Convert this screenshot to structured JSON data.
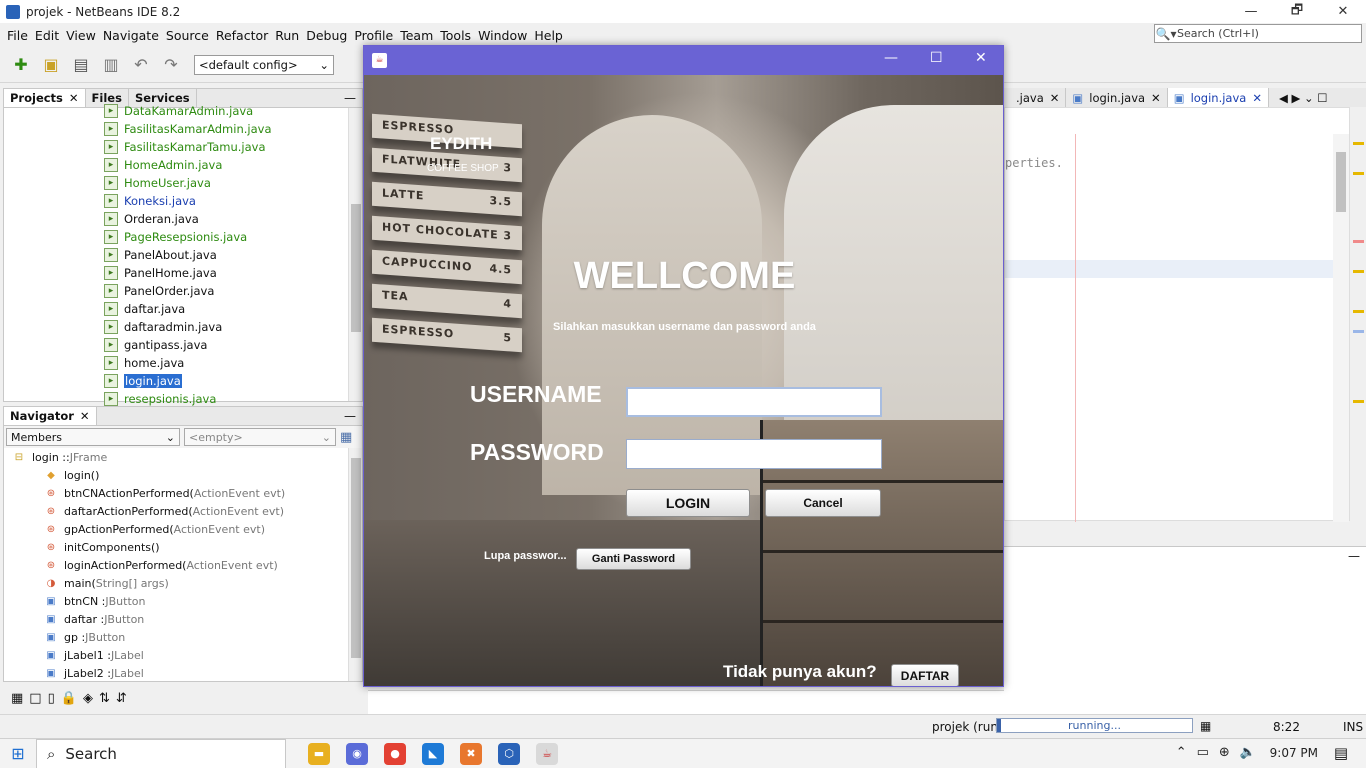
{
  "window": {
    "title": "projek - NetBeans IDE 8.2",
    "restore": "🗗",
    "close": "✕"
  },
  "menu": [
    "File",
    "Edit",
    "View",
    "Navigate",
    "Source",
    "Refactor",
    "Run",
    "Debug",
    "Profile",
    "Team",
    "Tools",
    "Window",
    "Help"
  ],
  "search": {
    "placeholder": "Search (Ctrl+I)"
  },
  "toolbar": {
    "config": "<default config>"
  },
  "projects_panel": {
    "tabs": [
      "Projects",
      "Files",
      "Services"
    ],
    "files": [
      {
        "name": "DataKamarAdmin.java",
        "color": "green"
      },
      {
        "name": "FasilitasKamarAdmin.java",
        "color": "green"
      },
      {
        "name": "FasilitasKamarTamu.java",
        "color": "green"
      },
      {
        "name": "HomeAdmin.java",
        "color": "green"
      },
      {
        "name": "HomeUser.java",
        "color": "green"
      },
      {
        "name": "Koneksi.java",
        "color": "blue"
      },
      {
        "name": "Orderan.java",
        "color": "normal"
      },
      {
        "name": "PageResepsionis.java",
        "color": "green"
      },
      {
        "name": "PanelAbout.java",
        "color": "normal"
      },
      {
        "name": "PanelHome.java",
        "color": "normal"
      },
      {
        "name": "PanelOrder.java",
        "color": "normal"
      },
      {
        "name": "daftar.java",
        "color": "normal"
      },
      {
        "name": "daftaradmin.java",
        "color": "normal"
      },
      {
        "name": "gantipass.java",
        "color": "normal"
      },
      {
        "name": "home.java",
        "color": "normal"
      },
      {
        "name": "login.java",
        "color": "selected"
      },
      {
        "name": "resepsionis.java",
        "color": "green"
      }
    ]
  },
  "navigator": {
    "title": "Navigator",
    "members_combo": "Members",
    "filter_combo": "<empty>",
    "items": [
      {
        "name": "login :: ",
        "type": "JFrame",
        "icon": "class-icon"
      },
      {
        "name": "login()",
        "type": "",
        "icon": "constructor-icon"
      },
      {
        "name": "btnCNActionPerformed(",
        "type": "ActionEvent evt)",
        "icon": "method-icon"
      },
      {
        "name": "daftarActionPerformed(",
        "type": "ActionEvent evt)",
        "icon": "method-icon"
      },
      {
        "name": "gpActionPerformed(",
        "type": "ActionEvent evt)",
        "icon": "method-icon"
      },
      {
        "name": "initComponents()",
        "type": "",
        "icon": "method-icon"
      },
      {
        "name": "loginActionPerformed(",
        "type": "ActionEvent evt)",
        "icon": "method-icon"
      },
      {
        "name": "main(",
        "type": "String[] args)",
        "icon": "static-method-icon"
      },
      {
        "name": "btnCN : ",
        "type": "JButton",
        "icon": "field-icon"
      },
      {
        "name": "daftar : ",
        "type": "JButton",
        "icon": "field-icon"
      },
      {
        "name": "gp : ",
        "type": "JButton",
        "icon": "field-icon"
      },
      {
        "name": "jLabel1 : ",
        "type": "JLabel",
        "icon": "field-icon"
      },
      {
        "name": "jLabel2 : ",
        "type": "JLabel",
        "icon": "field-icon"
      }
    ]
  },
  "editor": {
    "tabs": [
      {
        "label": ".java",
        "active": false
      },
      {
        "label": "login.java",
        "active": false
      },
      {
        "label": "login.java",
        "active": true
      }
    ],
    "visible_code": "perties."
  },
  "status": {
    "project": "projek (run)",
    "progress": "running...",
    "position": "8:22",
    "mode": "INS"
  },
  "taskbar": {
    "search": "Search",
    "time": "9:07 PM"
  },
  "login_form": {
    "brand": "EYDITH",
    "brand_sub": "COFFEE SHOP",
    "menu_board": [
      "ESPRESSO",
      "FLATWHITE",
      "LATTE",
      "HOT CHOCOLATE",
      "CAPPUCCINO",
      "TEA",
      "ESPRESSO"
    ],
    "menu_prices": [
      "",
      "3",
      "3.5",
      "3",
      "4.5",
      "4",
      "5"
    ],
    "welcome": "WELLCOME",
    "subtitle": "Silahkan masukkan username dan password anda",
    "username_label": "USERNAME",
    "password_label": "PASSWORD",
    "username_value": "",
    "password_value": "",
    "login_button": "LOGIN",
    "cancel_button": "Cancel",
    "forgot_label": "Lupa passwor...",
    "change_password_button": "Ganti Password",
    "no_account_label": "Tidak punya akun?",
    "register_button": "DAFTAR"
  }
}
